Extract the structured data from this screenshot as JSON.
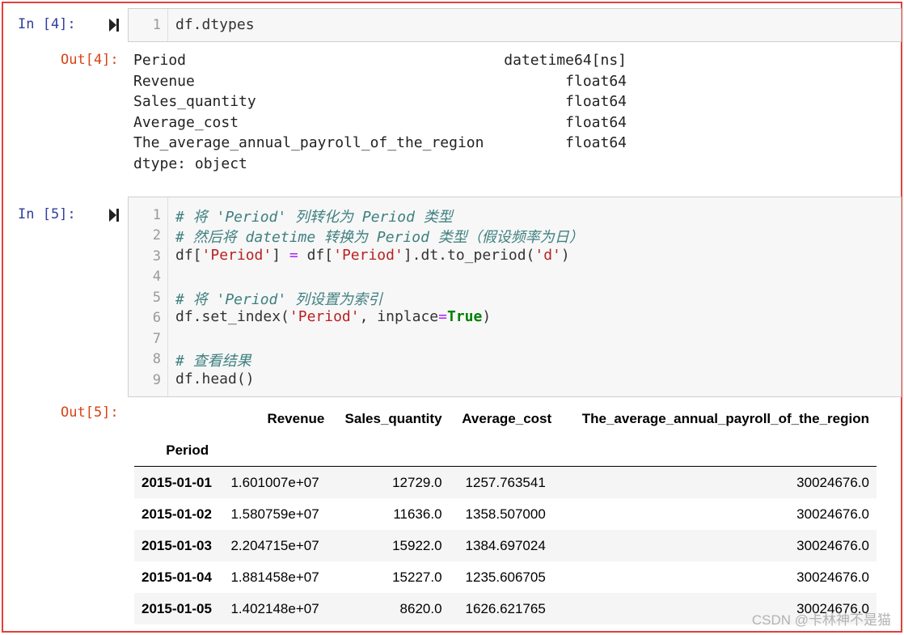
{
  "cell4": {
    "in_prompt": "In  [4]:",
    "out_prompt": "Out[4]:",
    "lines": [
      {
        "no": "1",
        "code": "df.dtypes"
      }
    ],
    "output": {
      "rows": [
        {
          "name": "Period",
          "type": "datetime64[ns]"
        },
        {
          "name": "Revenue",
          "type": "float64"
        },
        {
          "name": "Sales_quantity",
          "type": "float64"
        },
        {
          "name": "Average_cost",
          "type": "float64"
        },
        {
          "name": "The_average_annual_payroll_of_the_region",
          "type": "float64"
        }
      ],
      "footer": "dtype: object"
    }
  },
  "cell5": {
    "in_prompt": "In  [5]:",
    "out_prompt": "Out[5]:",
    "line_numbers": [
      "1",
      "2",
      "3",
      "4",
      "5",
      "6",
      "7",
      "8",
      "9"
    ],
    "code": {
      "l1": "# 将 'Period' 列转化为 Period 类型",
      "l2": "# 然后将 datetime 转换为 Period 类型（假设频率为日）",
      "l3_a": "df[",
      "l3_b": "'Period'",
      "l3_c": "] ",
      "l3_d": "=",
      "l3_e": " df[",
      "l3_f": "'Period'",
      "l3_g": "].dt.to_period(",
      "l3_h": "'d'",
      "l3_i": ")",
      "l5": "# 将 'Period' 列设置为索引",
      "l6_a": "df.set_index(",
      "l6_b": "'Period'",
      "l6_c": ", inplace",
      "l6_d": "=",
      "l6_e": "True",
      "l6_f": ")",
      "l8": "# 查看结果",
      "l9": "df.head()"
    },
    "table": {
      "columns": [
        "Revenue",
        "Sales_quantity",
        "Average_cost",
        "The_average_annual_payroll_of_the_region"
      ],
      "index_name": "Period",
      "rows": [
        {
          "index": "2015-01-01",
          "cells": [
            "1.601007e+07",
            "12729.0",
            "1257.763541",
            "30024676.0"
          ]
        },
        {
          "index": "2015-01-02",
          "cells": [
            "1.580759e+07",
            "11636.0",
            "1358.507000",
            "30024676.0"
          ]
        },
        {
          "index": "2015-01-03",
          "cells": [
            "2.204715e+07",
            "15922.0",
            "1384.697024",
            "30024676.0"
          ]
        },
        {
          "index": "2015-01-04",
          "cells": [
            "1.881458e+07",
            "15227.0",
            "1235.606705",
            "30024676.0"
          ]
        },
        {
          "index": "2015-01-05",
          "cells": [
            "1.402148e+07",
            "8620.0",
            "1626.621765",
            "30024676.0"
          ]
        }
      ]
    }
  },
  "watermark": "CSDN @卡林神不是猫",
  "colors": {
    "in_prompt": "#303f9f",
    "out_prompt": "#d84315",
    "comment": "#408080",
    "string": "#ba2121",
    "keyword": "#008000",
    "border": "#e0413c"
  },
  "icons": {
    "run": "run-cell-icon"
  }
}
